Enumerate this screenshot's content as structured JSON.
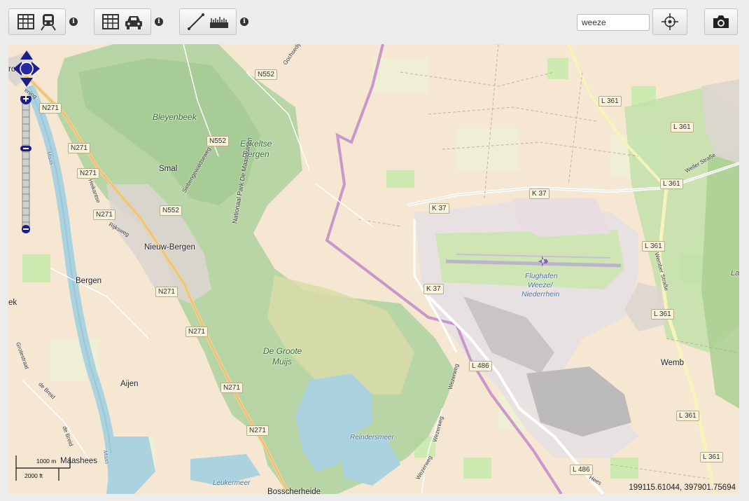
{
  "toolbar": {
    "buttons": [
      {
        "name": "train-table-button",
        "icons": [
          "table-icon",
          "train-icon"
        ]
      },
      {
        "name": "car-table-button",
        "icons": [
          "table-icon",
          "car-icon"
        ]
      },
      {
        "name": "measure-button",
        "icons": [
          "line-icon",
          "ruler-icon"
        ]
      }
    ],
    "info_label": "i",
    "search_value": "weeze",
    "locate_icon": "crosshair-icon",
    "screenshot_icon": "camera-icon"
  },
  "map": {
    "places": {
      "bleyenbeek": "Bleyenbeek",
      "eckeltse1": "Eckeltse",
      "eckeltse2": "Bergen",
      "smal": "Smal",
      "nieuw_bergen": "Nieuw-Bergen",
      "bergen": "Bergen",
      "groote1": "De Groote",
      "groote2": "Muijs",
      "aijen": "Aijen",
      "maashees": "Maashees",
      "wemb": "Wemb",
      "flughafen1": "Flughafen",
      "flughafen2": "Weeze/",
      "flughafen3": "Niederrhein",
      "reindersmeer": "Reindersmeer",
      "leukermeer": "Leukermeer",
      "bosscherheide": "Bosscherheide",
      "ek": "ek",
      "la": "La",
      "ro": "ro"
    },
    "streets": {
      "goch": "Gochsedijk",
      "nationaal_park": "Nationaal Park De Maasduinen",
      "siebengewald": "Siebengewaldseweg",
      "heikant": "Heikantse",
      "rijksweg": "Rijksweg",
      "groote_straat": "Grotestraat",
      "de_breid": "de Breid",
      "de_breid2": "de Breid",
      "weller": "Weller Straße",
      "wemb_str": "Wember Straße",
      "wezerweg": "Wezerweg",
      "wezerweg2": "Wezerweg",
      "wezerweg3": "Wezerweg",
      "hees": "Hees",
      "maas": "Maas",
      "maas2": "Maas",
      "kening": "ening"
    },
    "road_shields": {
      "n552a": "N552",
      "n552b": "N552",
      "n552c": "N552",
      "n271a": "N271",
      "n271b": "N271",
      "n271c": "N271",
      "n271d": "N271",
      "n271e": "N271",
      "n271f": "N271",
      "n271g": "N271",
      "n271h": "N271",
      "l361a": "L 361",
      "l361b": "L 361",
      "l361c": "L 361",
      "l361d": "L 361",
      "l361e": "L 361",
      "l361f": "L 361",
      "l361g": "L 361",
      "k37a": "K 37",
      "k37b": "K 37",
      "k37c": "K 37",
      "l486a": "L 486",
      "l486b": "L 486"
    },
    "scale": {
      "metric": "1000 m",
      "imperial": "2000 ft"
    },
    "coordinates": "199115.61044, 397901.75694",
    "colors": {
      "land": "#f5e7d2",
      "forest": "#add19e",
      "water": "#aad3df",
      "border": "#c890c8",
      "airport": "#e9e7e2"
    }
  }
}
